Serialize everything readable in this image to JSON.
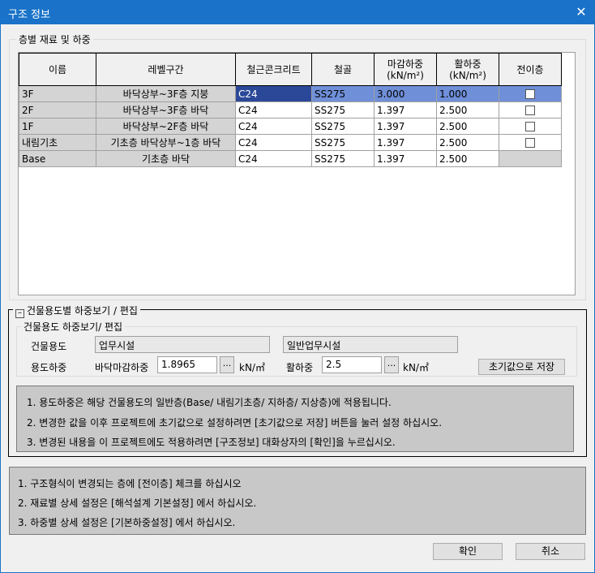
{
  "window": {
    "title": "구조 정보"
  },
  "floor_group": {
    "label": "층별 재료 및 하중",
    "columns": [
      "이름",
      "레벨구간",
      "철근콘크리트",
      "철골",
      "마감하중\n(kN/m²)",
      "활하중\n(kN/m²)",
      "전이층"
    ],
    "rows": [
      {
        "name": "3F",
        "range": "바닥상부~3F층 지붕",
        "rc": "C24",
        "steel": "SS275",
        "finish": "3.000",
        "live": "1.000",
        "transfer": "checkbox"
      },
      {
        "name": "2F",
        "range": "바닥상부~3F층 바닥",
        "rc": "C24",
        "steel": "SS275",
        "finish": "1.397",
        "live": "2.500",
        "transfer": "checkbox"
      },
      {
        "name": "1F",
        "range": "바닥상부~2F층 바닥",
        "rc": "C24",
        "steel": "SS275",
        "finish": "1.397",
        "live": "2.500",
        "transfer": "checkbox"
      },
      {
        "name": "내림기초",
        "range": "기초층 바닥상부~1층 바닥",
        "rc": "C24",
        "steel": "SS275",
        "finish": "1.397",
        "live": "2.500",
        "transfer": "checkbox"
      },
      {
        "name": "Base",
        "range": "기초층 바닥",
        "rc": "C24",
        "steel": "SS275",
        "finish": "1.397",
        "live": "2.500",
        "transfer": "none"
      }
    ]
  },
  "usage_group": {
    "title": "건물용도별 하중보기 / 편집",
    "inner_title": "건물용도 하중보기/ 편집",
    "usage_label": "건물용도",
    "usage_value": "업무시설",
    "usage_sub_value": "일반업무시설",
    "load_label": "용도하중",
    "finish_label": "바닥마감하중",
    "finish_value": "1.8965",
    "unit": "kN/㎡",
    "live_label": "활하중",
    "live_value": "2.5",
    "dots": "...",
    "save_default_label": "초기값으로 저장",
    "notes": [
      "1. 용도하중은 해당 건물용도의 일반층(Base/ 내림기초층/ 지하층/ 지상층)에 적용됩니다.",
      "2. 변경한 값을 이후 프로젝트에 초기값으로 설정하려면 [초기값으로 저장] 버튼을 눌러 설정 하십시오.",
      "3. 변경된 내용을 이 프로젝트에도 적용하려면 [구조정보] 대화상자의 [확인]을 누르십시오."
    ]
  },
  "general_notes": [
    "1. 구조형식이 변경되는 층에 [전이층] 체크를 하십시오",
    "2. 재료별 상세 설정은 [해석설계 기본설정] 에서 하십시오.",
    "3. 하중별 상세 설정은 [기본하중설정] 에서 하십시오."
  ],
  "buttons": {
    "ok": "확인",
    "cancel": "취소"
  }
}
